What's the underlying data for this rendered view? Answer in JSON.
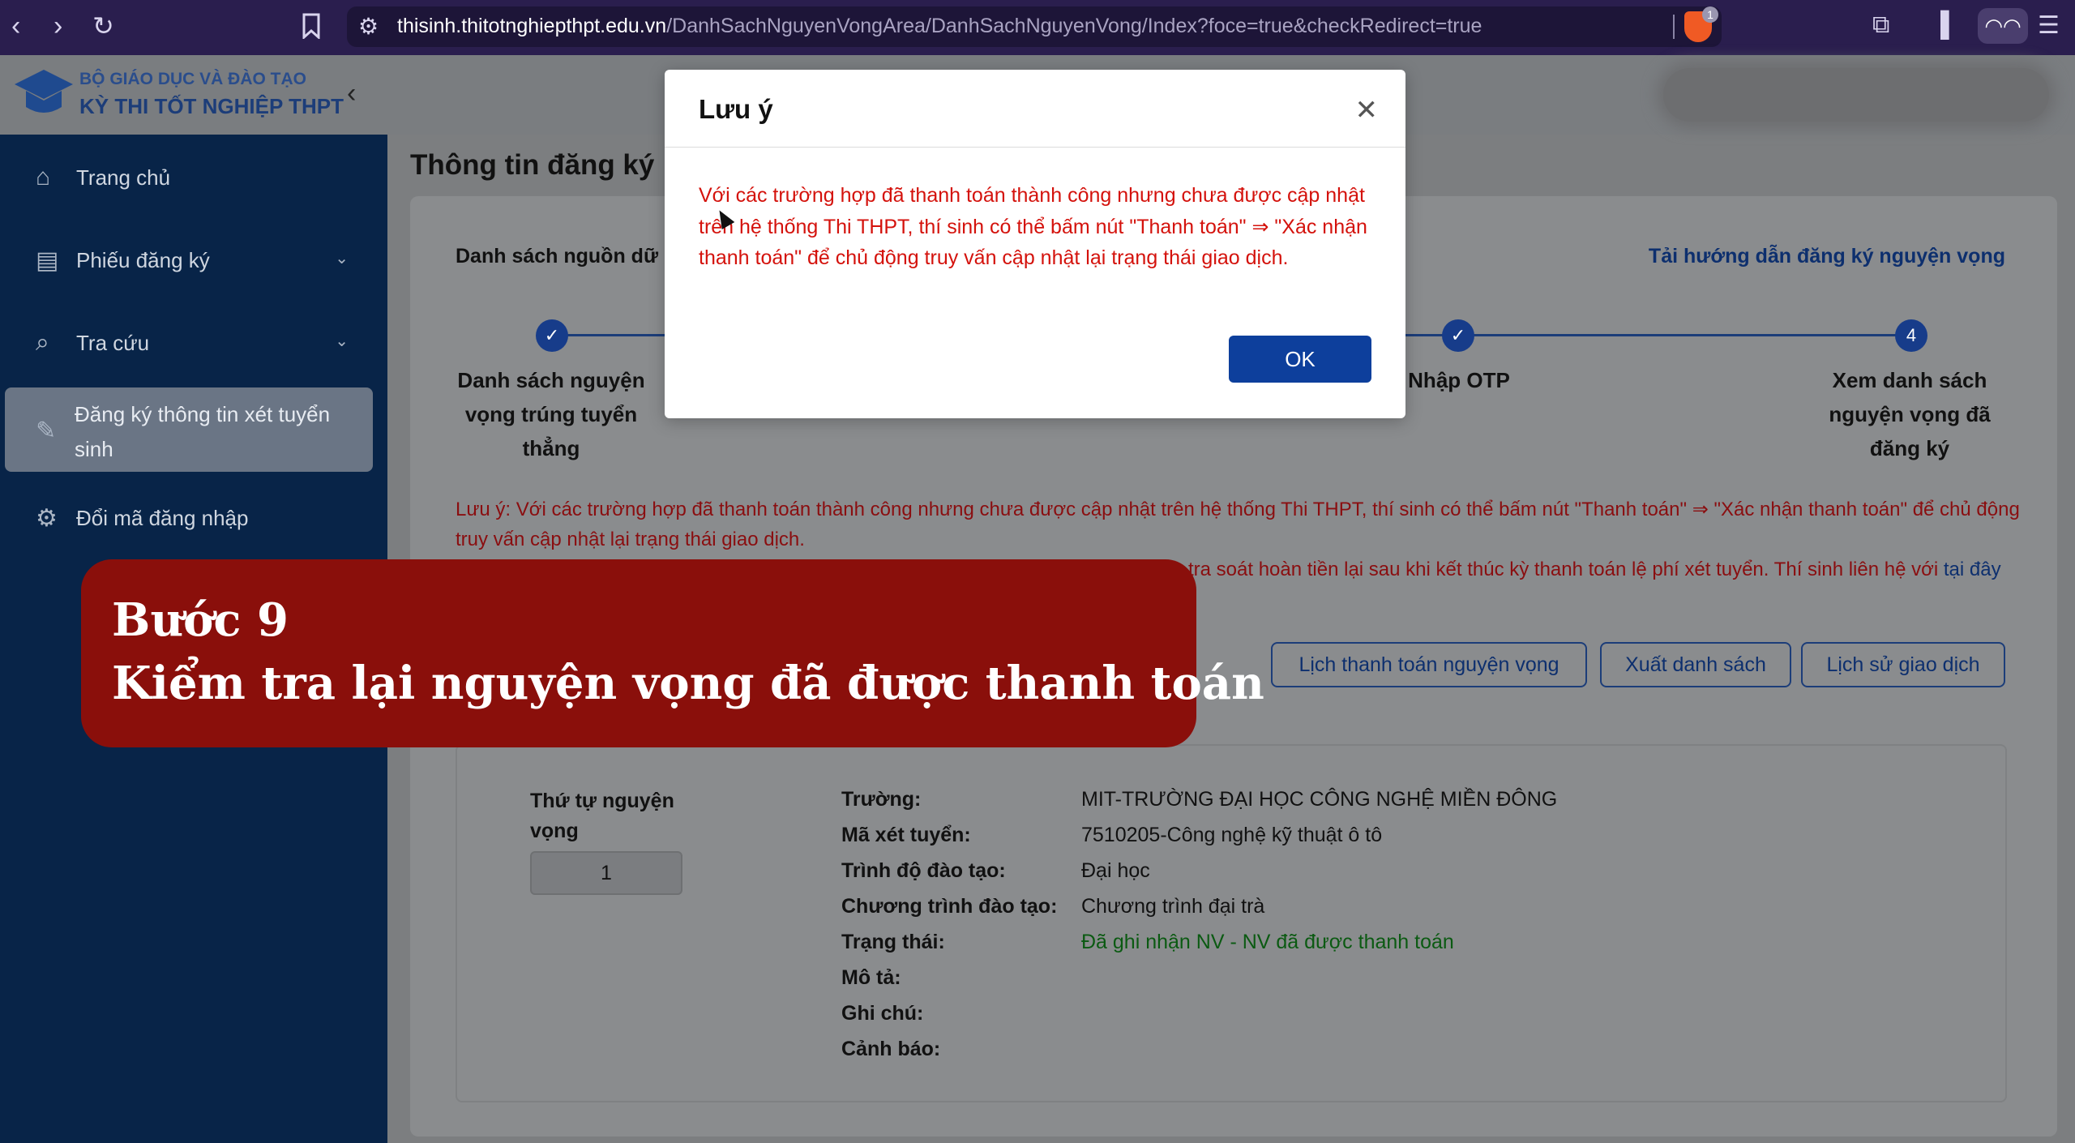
{
  "browser": {
    "url_host": "thisinh.thitotnghiepthpt.edu.vn",
    "url_path": "/DanhSachNguyenVongArea/DanhSachNguyenVong/Index?foce=true&checkRedirect=true",
    "shield_count": "1",
    "icons": [
      "back-icon",
      "forward-icon",
      "reload-icon",
      "bookmark-icon",
      "site-settings-icon",
      "brave-shield-icon",
      "screenshot-icon",
      "sidebar-icon",
      "private-glasses-icon",
      "menu-icon"
    ]
  },
  "header": {
    "org_line1": "BỘ GIÁO DỤC VÀ ĐÀO TẠO",
    "org_line2": "KỲ THI TỐT NGHIỆP THPT"
  },
  "sidebar": {
    "items": [
      {
        "label": "Trang chủ",
        "icon": "home-icon"
      },
      {
        "label": "Phiếu đăng ký",
        "icon": "document-icon"
      },
      {
        "label": "Tra cứu",
        "icon": "search-icon"
      },
      {
        "label": "Đăng ký thông tin xét tuyển sinh",
        "icon": "edit-icon"
      },
      {
        "label": "Đổi mã đăng nhập",
        "icon": "gear-icon"
      }
    ]
  },
  "main": {
    "page_title": "Thông tin đăng ký",
    "data_source_label": "Danh sách nguồn dữ l",
    "guide_link": "Tải hướng dẫn đăng ký nguyện vọng",
    "steps": [
      {
        "label": "Danh sách nguyện vọng trúng tuyển thẳng",
        "marker": "✓"
      },
      {
        "label": "Nhập OTP",
        "marker": "✓"
      },
      {
        "label": "Xem danh sách nguyện vọng đã đăng ký",
        "marker": "4"
      }
    ],
    "note1": "Lưu ý: Với các trường hợp đã thanh toán thành công nhưng chưa được cập nhật trên hệ thống Thi THPT, thí sinh có thể bấm nút \"Thanh toán\" ⇒ \"Xác nhận thanh toán\" để chủ động truy vấn cập nhật lại trạng thái giao dịch.",
    "note2_text": "tra soát hoàn tiền lại sau khi kết thúc kỳ thanh toán lệ phí xét tuyển. Thí sinh liên hệ với",
    "note2_link": "tại đây",
    "buttons": {
      "payment_schedule": "Lịch thanh toán nguyện vọng",
      "export_list": "Xuất danh sách",
      "transaction_history": "Lịch sử giao dịch"
    },
    "wish": {
      "order_label": "Thứ tự nguyện vọng",
      "order_value": "1",
      "fields": [
        {
          "label": "Trường:",
          "value": "MIT-TRƯỜNG ĐẠI HỌC CÔNG NGHỆ MIỀN ĐÔNG"
        },
        {
          "label": "Mã xét tuyển:",
          "value": "7510205-Công nghệ kỹ thuật ô tô"
        },
        {
          "label": "Trình độ đào tạo:",
          "value": "Đại học"
        },
        {
          "label": "Chương trình đào tạo:",
          "value": "Chương trình đại trà"
        },
        {
          "label": "Trạng thái:",
          "value": "Đã ghi nhận NV - NV đã được thanh toán"
        },
        {
          "label": "Mô tả:",
          "value": ""
        },
        {
          "label": "Ghi chú:",
          "value": ""
        },
        {
          "label": "Cảnh báo:",
          "value": ""
        }
      ],
      "status_color": "#0b5a12"
    }
  },
  "overlay": {
    "line1": "Bước 9",
    "line2": "Kiểm tra lại nguyện vọng đã được thanh toán",
    "color": "#8a0f0b"
  },
  "modal": {
    "title": "Lưu ý",
    "message": "Với các trường hợp đã thanh toán thành công nhưng chưa được cập nhật trên hệ thống Thi THPT, thí sinh có thể bấm nút \"Thanh toán\" ⇒ \"Xác nhận thanh toán\" để chủ động truy vấn cập nhật lại trạng thái giao dịch.",
    "ok_label": "OK",
    "message_color": "#d4120c",
    "button_color": "#0d3f9c"
  }
}
